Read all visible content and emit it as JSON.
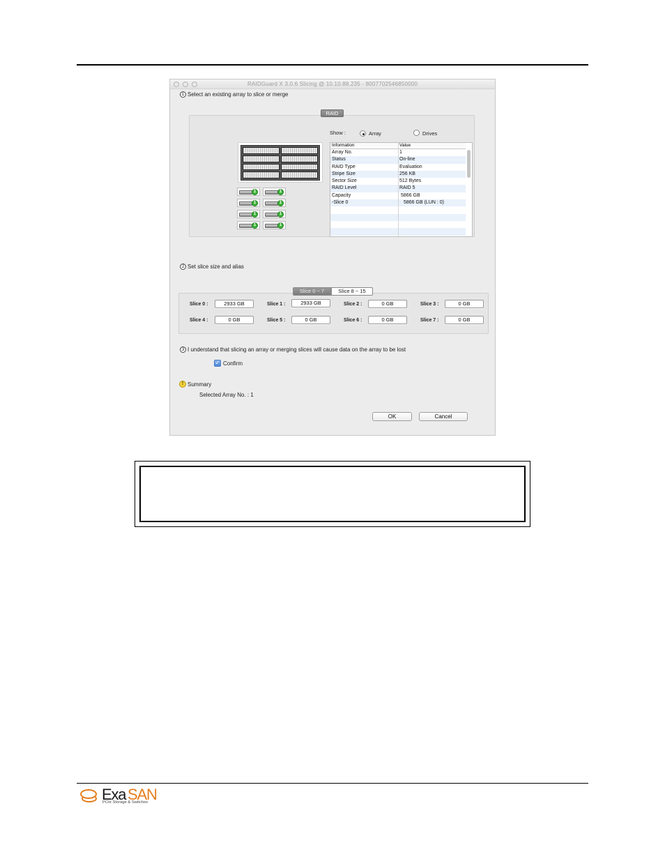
{
  "window": {
    "title": "RAIDGuard X 3.0.6 Slicing @ 10.10.88.235 - 8007702546850000"
  },
  "step1": {
    "number": "1",
    "label": "Select an existing array to slice or merge",
    "tab_label": "RAID",
    "show_label": "Show :",
    "radio_array": "Array",
    "radio_drives": "Drives",
    "selected_radio": "Array",
    "drive_badge": "1",
    "table": {
      "headers": [
        "Information",
        "Value"
      ],
      "rows": [
        {
          "info": "Array No.",
          "value": "1"
        },
        {
          "info": "Status",
          "value": "On-line"
        },
        {
          "info": "RAID Type",
          "value": "Evaluation"
        },
        {
          "info": "Stripe Size",
          "value": "256 KB"
        },
        {
          "info": "Sector Size",
          "value": "512 Bytes"
        },
        {
          "info": "RAID Level",
          "value": "RAID 5"
        },
        {
          "info": "Capacity",
          "value": "5866 GB"
        },
        {
          "info": "-Slice 0",
          "value": "5866 GB (LUN : 0)"
        }
      ]
    }
  },
  "step2": {
    "number": "2",
    "label": "Set slice size and alias",
    "tabs": [
      "Slice 0 ~ 7",
      "Slice 8 ~ 15"
    ],
    "slices": [
      {
        "label": "Slice 0 :",
        "value": "2933 GB"
      },
      {
        "label": "Slice 1 :",
        "value": "2933 GB"
      },
      {
        "label": "Slice 2 :",
        "value": "0 GB"
      },
      {
        "label": "Slice 3 :",
        "value": "0 GB"
      },
      {
        "label": "Slice 4 :",
        "value": "0 GB"
      },
      {
        "label": "Slice 5 :",
        "value": "0 GB"
      },
      {
        "label": "Slice 6 :",
        "value": "0 GB"
      },
      {
        "label": "Slice 7 :",
        "value": "0 GB"
      }
    ]
  },
  "step3": {
    "number": "3",
    "label": "I understand that slicing an array or merging slices will cause data on the array to be lost",
    "confirm_label": "Confirm",
    "confirm_checked": true
  },
  "summary": {
    "icon_text": "!",
    "label": "Summary",
    "text": "Selected Array No. : 1"
  },
  "buttons": {
    "ok": "OK",
    "cancel": "Cancel"
  },
  "logo": {
    "name_part1": "Exa",
    "name_part2": "SAN",
    "tagline": "PCIe Storage & Switches"
  },
  "colors": {
    "brand_orange": "#e57e1e",
    "drive_ok_green": "#3fb43a"
  }
}
